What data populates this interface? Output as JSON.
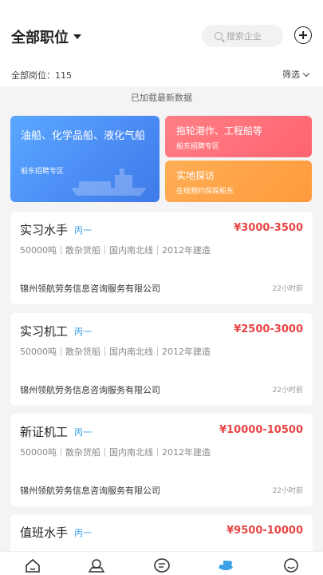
{
  "header": {
    "title": "全部职位",
    "search_placeholder": "搜索企业"
  },
  "summary": {
    "count_label": "全部岗位：115",
    "filter_label": "筛选"
  },
  "notice": "已加载最新数据",
  "banners": {
    "tanker": {
      "title": "油船、化学品船、液化气船",
      "subtitle": "船东招聘专区"
    },
    "tug": {
      "title": "拖轮港作、工程船等",
      "subtitle": "船东招聘专区"
    },
    "visit": {
      "title": "实地探访",
      "subtitle": "在线预约探探船东"
    }
  },
  "jobs": [
    {
      "title": "实习水手",
      "tag": "丙一",
      "salary": "¥3000-3500",
      "meta": "50000吨｜散杂货船｜国内南北线｜2012年建造",
      "company": "锦州领航劳务信息咨询服务有限公司",
      "time": "22小时前"
    },
    {
      "title": "实习机工",
      "tag": "丙一",
      "salary": "¥2500-3000",
      "meta": "50000吨｜散杂货船｜国内南北线｜2012年建造",
      "company": "锦州领航劳务信息咨询服务有限公司",
      "time": "22小时前"
    },
    {
      "title": "新证机工",
      "tag": "丙一",
      "salary": "¥10000-10500",
      "meta": "50000吨｜散杂货船｜国内南北线｜2012年建造",
      "company": "锦州领航劳务信息咨询服务有限公司",
      "time": "22小时前"
    },
    {
      "title": "值班水手",
      "tag": "丙一",
      "salary": "¥9500-10000"
    }
  ],
  "tabbar": {
    "icons": [
      "home-icon",
      "crew-icon",
      "message-icon",
      "jobs-icon",
      "profile-icon"
    ],
    "active_color": "#3ba2e8"
  }
}
